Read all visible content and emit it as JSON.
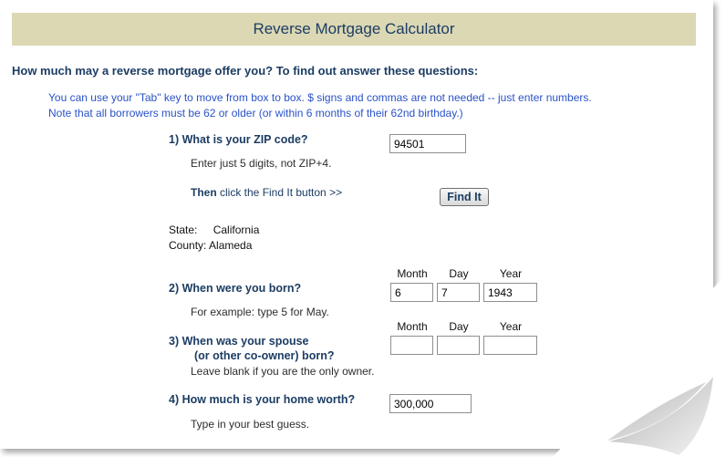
{
  "title": "Reverse Mortgage Calculator",
  "lead": "How much may a reverse mortgage offer you? To find out answer these questions:",
  "notes": [
    "You can use your \"Tab\" key to move from box to box. $ signs and commas are not needed -- just enter numbers.",
    "Note that all borrowers must be 62 or older (or within 6 months of their 62nd birthday.)"
  ],
  "q1": {
    "label": "1) What is your ZIP code?",
    "value": "94501",
    "hint": "Enter just 5 digits, not ZIP+4.",
    "then_bold": "Then",
    "then_text": " click the Find It button >>",
    "button": "Find It"
  },
  "location": {
    "state_label": "State:",
    "state_value": "California",
    "county_label": "County:",
    "county_value": "Alameda"
  },
  "columns": {
    "month": "Month",
    "day": "Day",
    "year": "Year"
  },
  "q2": {
    "label": "2) When were you born?",
    "month": "6",
    "day": "7",
    "year": "1943",
    "hint": "For example: type 5 for May."
  },
  "q3": {
    "label_line1": "3) When was your spouse",
    "label_line2": "(or other co-owner) born?",
    "month": "",
    "day": "",
    "year": "",
    "hint": "Leave blank if you are the only owner."
  },
  "q4": {
    "label": "4) How much is your home worth?",
    "value": "300,000",
    "hint": "Type in your best guess."
  }
}
